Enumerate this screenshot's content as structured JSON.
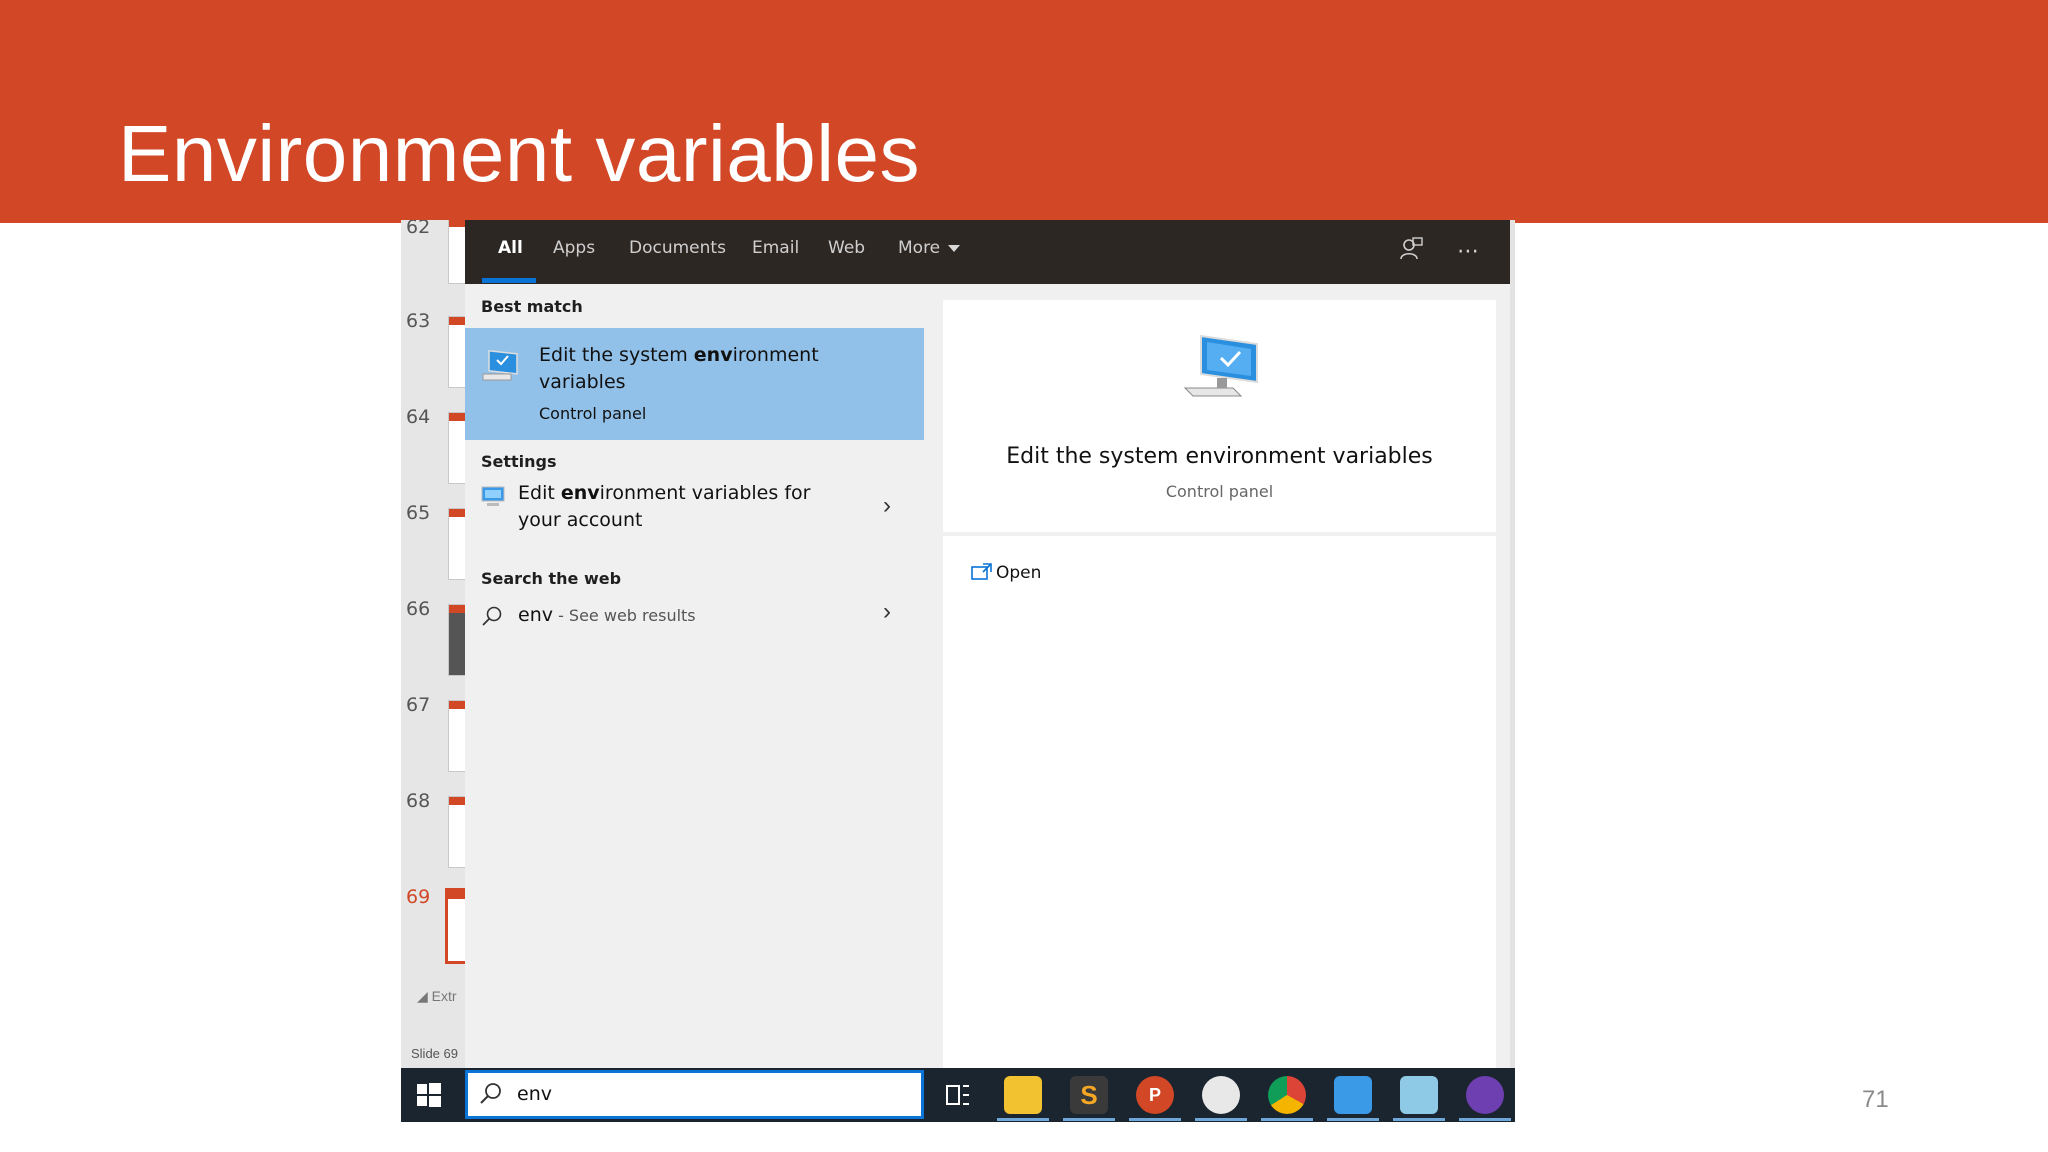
{
  "slide": {
    "title": "Environment variables",
    "page_number": "71"
  },
  "colors": {
    "brand_orange": "#d24726",
    "flyout_dark": "#2d2724",
    "selection_blue": "#91c0e8",
    "accent_blue": "#0a73d6",
    "taskbar": "#1b2530"
  },
  "ppt_pane": {
    "slide_numbers": [
      "62",
      "63",
      "64",
      "65",
      "66",
      "67",
      "68",
      "69"
    ],
    "active_slide": "69",
    "extra_text": "Extr",
    "status": "Slide 69"
  },
  "search_flyout": {
    "tabs": [
      "All",
      "Apps",
      "Documents",
      "Email",
      "Web",
      "More"
    ],
    "active_tab": "All",
    "top_icons": [
      "feedback-icon",
      "more-options-icon"
    ],
    "best_match": {
      "heading": "Best match",
      "title_pre": "Edit the system ",
      "title_bold": "env",
      "title_post": "ironment variables",
      "subtitle": "Control panel",
      "icon": "computer-check-icon"
    },
    "settings": {
      "heading": "Settings",
      "title_pre": "Edit ",
      "title_bold": "env",
      "title_post": "ironment variables for your account",
      "icon": "monitor-settings-icon"
    },
    "web": {
      "heading": "Search the web",
      "query": "env",
      "suffix": " - See web results",
      "icon": "search-icon"
    },
    "preview": {
      "title": "Edit the system environment variables",
      "subtitle": "Control panel",
      "open_label": "Open",
      "open_icon": "open-external-icon"
    }
  },
  "taskbar": {
    "search_value": "env",
    "apps": [
      "task-view-icon",
      "file-explorer-icon",
      "sublime-text-icon",
      "powerpoint-icon",
      "paint-icon",
      "chrome-icon",
      "control-panel-icon",
      "notepad-icon",
      "github-icon"
    ]
  }
}
